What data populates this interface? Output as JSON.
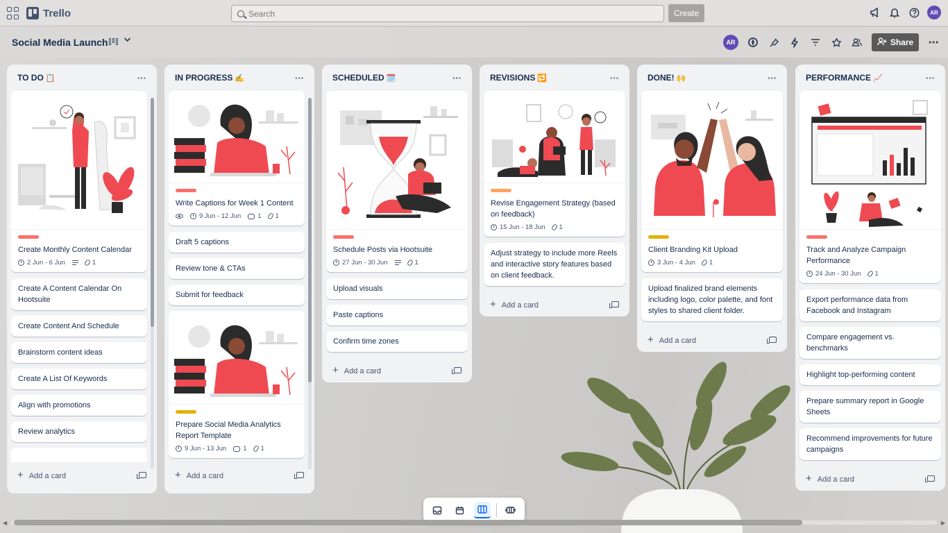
{
  "app": {
    "name": "Trello"
  },
  "search": {
    "placeholder": "Search"
  },
  "create_label": "Create",
  "user_initials": "AR",
  "board": {
    "title": "Social Media Launch",
    "share_label": "Share"
  },
  "lists": {
    "todo": {
      "title": "TO DO",
      "emoji": "📋",
      "cover_card": {
        "text": "Create Monthly Content Calendar",
        "dates": "2 Jun - 6 Jun",
        "attachments": "1"
      },
      "cards": [
        "Create A Content Calendar On Hootsuite",
        "Create Content And Schedule",
        "Brainstorm content ideas",
        "Create A List Of Keywords",
        "Align with promotions",
        "Review analytics"
      ],
      "add_label": "Add a card"
    },
    "inprogress": {
      "title": "IN PROGRESS",
      "emoji": "✍️",
      "cover_card": {
        "text": "Write Captions for Week 1 Content",
        "dates": "9 Jun - 12 Jun",
        "comments": "1",
        "attachments": "1"
      },
      "cards": [
        "Draft 5 captions",
        "Review tone & CTAs",
        "Submit for feedback"
      ],
      "cover_card2": {
        "text": "Prepare Social Media Analytics Report Template",
        "dates": "9 Jun - 13 Jun",
        "comments": "1",
        "attachments": "1"
      },
      "add_label": "Add a card"
    },
    "scheduled": {
      "title": "SCHEDULED",
      "emoji": "🗓️",
      "cover_card": {
        "text": "Schedule Posts via Hootsuite",
        "dates": "27 Jun - 30 Jun",
        "attachments": "1"
      },
      "cards": [
        "Upload visuals",
        "Paste captions",
        "Confirm time zones"
      ],
      "add_label": "Add a card"
    },
    "revisions": {
      "title": "REVISIONS",
      "emoji": "🔁",
      "cover_card": {
        "text": "Revise Engagement Strategy (based on feedback)",
        "dates": "15 Jun - 18 Jun",
        "attachments": "1"
      },
      "cards": [
        "Adjust strategy to include more Reels and interactive story features based on client feedback."
      ],
      "add_label": "Add a card"
    },
    "done": {
      "title": "DONE!",
      "emoji": "🙌",
      "cover_card": {
        "text": "Client Branding Kit Upload",
        "dates": "3 Jun - 4 Jun",
        "attachments": "1"
      },
      "cards": [
        "Upload finalized brand elements including logo, color palette, and font styles to shared client folder."
      ],
      "add_label": "Add a card"
    },
    "performance": {
      "title": "PERFORMANCE",
      "emoji": "📈",
      "cover_card": {
        "text": "Track and Analyze Campaign Performance",
        "dates": "24 Jun - 30 Jun",
        "attachments": "1"
      },
      "cards": [
        "Export performance data from Facebook and Instagram",
        "Compare engagement vs. benchmarks",
        "Highlight top-performing content",
        "Prepare summary report in Google Sheets",
        "Recommend improvements for future campaigns"
      ],
      "add_label": "Add a card"
    }
  },
  "colors": {
    "label_red": "#f87168",
    "label_orange": "#fea362",
    "label_yellow": "#e2b203",
    "accent": "#0c66e4",
    "illustration_red": "#ef4a52"
  }
}
